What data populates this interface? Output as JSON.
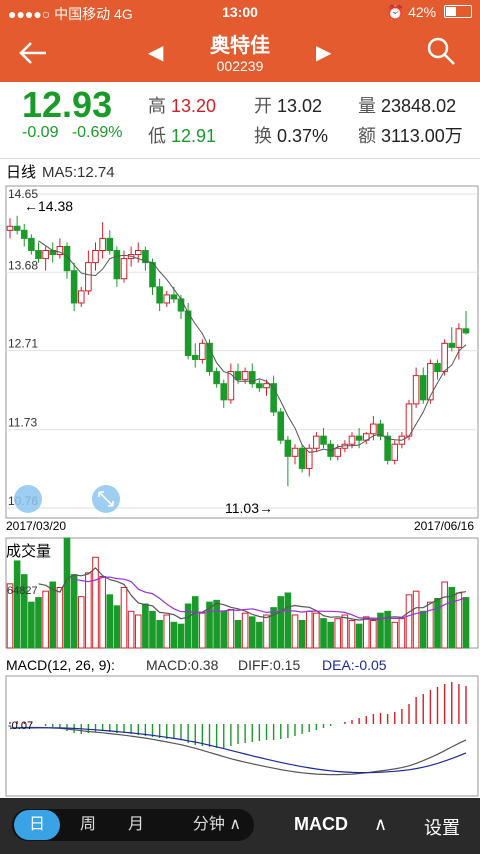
{
  "status": {
    "carrier": "●●●●○ 中国移动  4G",
    "time": "13:00",
    "battery": "42%",
    "battery_level": 0.42
  },
  "nav": {
    "name": "奥特佳",
    "code": "002239"
  },
  "quote": {
    "price": "12.93",
    "change": "-0.09",
    "change_pct": "-0.69%",
    "high_label": "高",
    "high": "13.20",
    "low_label": "低",
    "low": "12.91",
    "open_label": "开",
    "open": "13.02",
    "turnover_label": "换",
    "turnover": "0.37%",
    "vol_label": "量",
    "vol": "23848.02",
    "amt_label": "额",
    "amt": "3113.00万"
  },
  "kline": {
    "title": "日线",
    "ma_label": "MA5:12.74",
    "y_ticks": [
      "14.65",
      "13.68",
      "12.71",
      "11.73",
      "10.76"
    ],
    "max_label": "←14.38",
    "min_label": "11.03→",
    "date_start": "2017/03/20",
    "date_end": "2017/06/16"
  },
  "volume": {
    "title": "成交量",
    "value_label": "64827"
  },
  "macd": {
    "title": "MACD(12, 26, 9):",
    "macd": "MACD:0.38",
    "diff": "DIFF:0.15",
    "dea": "DEA:-0.05",
    "y_tick": "-0.07"
  },
  "toolbar": {
    "tabs": [
      "日",
      "周",
      "月",
      "分钟 ∧"
    ],
    "indicator": "MACD",
    "arrow": "∧",
    "settings": "设置"
  },
  "colors": {
    "accent": "#e35b2e",
    "up": "#d2202a",
    "down": "#1a9a28",
    "tab_active": "#3aa3e6"
  },
  "chart_data": {
    "type": "candlestick",
    "y_range": [
      10.76,
      14.65
    ],
    "ohlc": [
      [
        14.2,
        14.35,
        14.1,
        14.25
      ],
      [
        14.25,
        14.38,
        14.15,
        14.2
      ],
      [
        14.2,
        14.28,
        14.0,
        14.1
      ],
      [
        14.1,
        14.15,
        13.9,
        13.95
      ],
      [
        13.95,
        14.05,
        13.8,
        13.85
      ],
      [
        13.85,
        14.0,
        13.7,
        13.95
      ],
      [
        13.95,
        14.05,
        13.8,
        13.9
      ],
      [
        13.9,
        14.1,
        13.85,
        14.0
      ],
      [
        14.0,
        14.05,
        13.6,
        13.7
      ],
      [
        13.7,
        13.8,
        13.2,
        13.3
      ],
      [
        13.3,
        13.5,
        13.25,
        13.45
      ],
      [
        13.45,
        13.95,
        13.4,
        13.8
      ],
      [
        13.8,
        14.05,
        13.7,
        13.95
      ],
      [
        13.95,
        14.3,
        13.85,
        14.1
      ],
      [
        14.1,
        14.2,
        13.9,
        13.95
      ],
      [
        13.95,
        14.0,
        13.5,
        13.6
      ],
      [
        13.6,
        13.95,
        13.55,
        13.85
      ],
      [
        13.85,
        14.0,
        13.75,
        13.9
      ],
      [
        13.9,
        14.05,
        13.8,
        13.95
      ],
      [
        13.95,
        14.0,
        13.7,
        13.8
      ],
      [
        13.8,
        13.85,
        13.4,
        13.5
      ],
      [
        13.5,
        13.6,
        13.2,
        13.3
      ],
      [
        13.3,
        13.45,
        13.25,
        13.4
      ],
      [
        13.4,
        13.5,
        13.3,
        13.35
      ],
      [
        13.35,
        13.4,
        13.1,
        13.2
      ],
      [
        13.2,
        13.3,
        12.6,
        12.65
      ],
      [
        12.65,
        12.8,
        12.5,
        12.6
      ],
      [
        12.6,
        12.85,
        12.55,
        12.8
      ],
      [
        12.8,
        12.85,
        12.4,
        12.45
      ],
      [
        12.45,
        12.5,
        12.25,
        12.3
      ],
      [
        12.3,
        12.35,
        12.0,
        12.1
      ],
      [
        12.1,
        12.55,
        12.05,
        12.45
      ],
      [
        12.45,
        12.55,
        12.3,
        12.35
      ],
      [
        12.35,
        12.5,
        12.3,
        12.45
      ],
      [
        12.45,
        12.55,
        12.25,
        12.3
      ],
      [
        12.3,
        12.35,
        12.2,
        12.25
      ],
      [
        12.25,
        12.35,
        12.15,
        12.3
      ],
      [
        12.3,
        12.4,
        11.9,
        11.95
      ],
      [
        11.95,
        12.0,
        11.55,
        11.6
      ],
      [
        11.6,
        11.65,
        11.03,
        11.4
      ],
      [
        11.4,
        11.55,
        11.3,
        11.5
      ],
      [
        11.5,
        11.55,
        11.2,
        11.25
      ],
      [
        11.25,
        11.55,
        11.15,
        11.5
      ],
      [
        11.5,
        11.7,
        11.45,
        11.65
      ],
      [
        11.65,
        11.75,
        11.5,
        11.55
      ],
      [
        11.55,
        11.6,
        11.35,
        11.4
      ],
      [
        11.4,
        11.55,
        11.35,
        11.5
      ],
      [
        11.5,
        11.6,
        11.45,
        11.55
      ],
      [
        11.55,
        11.7,
        11.5,
        11.65
      ],
      [
        11.65,
        11.75,
        11.5,
        11.6
      ],
      [
        11.6,
        11.7,
        11.55,
        11.68
      ],
      [
        11.68,
        11.9,
        11.6,
        11.8
      ],
      [
        11.8,
        11.85,
        11.6,
        11.65
      ],
      [
        11.65,
        11.7,
        11.3,
        11.35
      ],
      [
        11.35,
        11.6,
        11.3,
        11.55
      ],
      [
        11.55,
        11.7,
        11.5,
        11.65
      ],
      [
        11.65,
        12.1,
        11.6,
        12.05
      ],
      [
        12.05,
        12.5,
        12.0,
        12.4
      ],
      [
        12.4,
        12.5,
        12.05,
        12.1
      ],
      [
        12.1,
        12.6,
        12.05,
        12.55
      ],
      [
        12.55,
        12.6,
        12.35,
        12.45
      ],
      [
        12.45,
        12.85,
        12.4,
        12.8
      ],
      [
        12.8,
        13.0,
        12.7,
        12.75
      ],
      [
        12.75,
        13.05,
        12.6,
        12.98
      ],
      [
        12.98,
        13.2,
        12.91,
        12.93
      ]
    ],
    "volume": [
      70,
      95,
      80,
      50,
      55,
      62,
      72,
      66,
      120,
      80,
      56,
      82,
      99,
      78,
      58,
      46,
      66,
      40,
      36,
      48,
      40,
      30,
      36,
      28,
      26,
      48,
      56,
      38,
      50,
      52,
      40,
      42,
      30,
      38,
      34,
      28,
      36,
      44,
      56,
      60,
      36,
      30,
      40,
      38,
      32,
      28,
      32,
      36,
      30,
      26,
      34,
      30,
      38,
      40,
      28,
      32,
      58,
      62,
      40,
      50,
      54,
      72,
      66,
      60,
      55
    ],
    "macd_hist": [
      0.02,
      0.03,
      0.02,
      0.01,
      0.0,
      -0.02,
      -0.03,
      -0.04,
      -0.07,
      -0.09,
      -0.1,
      -0.09,
      -0.08,
      -0.07,
      -0.08,
      -0.09,
      -0.09,
      -0.1,
      -0.11,
      -0.12,
      -0.13,
      -0.14,
      -0.15,
      -0.15,
      -0.16,
      -0.19,
      -0.21,
      -0.22,
      -0.23,
      -0.24,
      -0.24,
      -0.22,
      -0.2,
      -0.19,
      -0.18,
      -0.17,
      -0.16,
      -0.16,
      -0.15,
      -0.14,
      -0.12,
      -0.1,
      -0.08,
      -0.06,
      -0.04,
      -0.02,
      0.0,
      0.02,
      0.04,
      0.06,
      0.08,
      0.1,
      0.11,
      0.1,
      0.12,
      0.15,
      0.2,
      0.27,
      0.3,
      0.34,
      0.37,
      0.4,
      0.42,
      0.4,
      0.38
    ]
  }
}
